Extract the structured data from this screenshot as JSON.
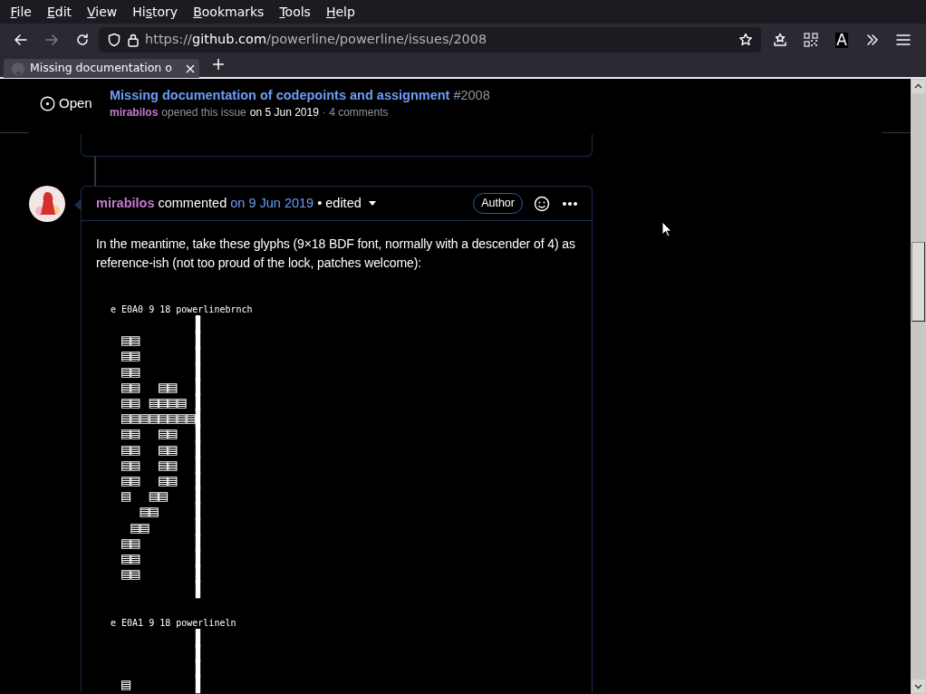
{
  "menu_bar": [
    {
      "access_key": "F",
      "rest": "ile"
    },
    {
      "access_key": "E",
      "rest": "dit"
    },
    {
      "access_key": "V",
      "rest": "iew"
    },
    {
      "lead": "Hi",
      "access_key": "s",
      "rest": "tory"
    },
    {
      "access_key": "B",
      "rest": "ookmarks"
    },
    {
      "access_key": "T",
      "rest": "ools"
    },
    {
      "access_key": "H",
      "rest": "elp"
    }
  ],
  "navigation": {
    "back_enabled": true,
    "forward_enabled": false
  },
  "address_bar": {
    "scheme": "https://",
    "host": "github.com",
    "path": "/powerline/powerline/issues/2008"
  },
  "extension_letter": "A",
  "tabs": [
    {
      "title": "Missing documentation o",
      "selected": true
    }
  ],
  "issue_header": {
    "status": "Open",
    "title": "Missing documentation of codepoints and assignment",
    "number": "#2008",
    "author": "mirabilos",
    "action": "opened this issue",
    "date": "on 5 Jun 2019",
    "comments": "· 4 comments"
  },
  "comment": {
    "author": "mirabilos",
    "action": "commented",
    "date": "on 9 Jun 2019",
    "edited": "• edited",
    "badge": "Author",
    "body": "In the meantime, take these glyphs (9×18 BDF font, normally with a descender of 4) as reference-ish (not too proud of the lock, patches welcome):",
    "code_blocks": [
      {
        "label": "e E0A0 9 18 powerlinebrnch",
        "rows": [
          "        ▌",
          "▤▤      ▌",
          "▤▤      ▌",
          "▤▤      ▌",
          "▤▤  ▤▤  ▌",
          "▤▤ ▤▤▤▤ ▌",
          "▤▤▤▤▤▤▤▤▌",
          "▤▤  ▤▤  ▌",
          "▤▤  ▤▤  ▌",
          "▤▤  ▤▤  ▌",
          "▤▤  ▤▤  ▌",
          "▤  ▤▤   ▌",
          "  ▤▤    ▌",
          " ▤▤     ▌",
          "▤▤      ▌",
          "▤▤      ▌",
          "▤▤      ▌",
          "        ▌"
        ]
      },
      {
        "label": "e E0A1 9 18 powerlineln",
        "rows": [
          "        ▌",
          "        ▌",
          "        ▌",
          "▤       ▌"
        ]
      }
    ]
  }
}
